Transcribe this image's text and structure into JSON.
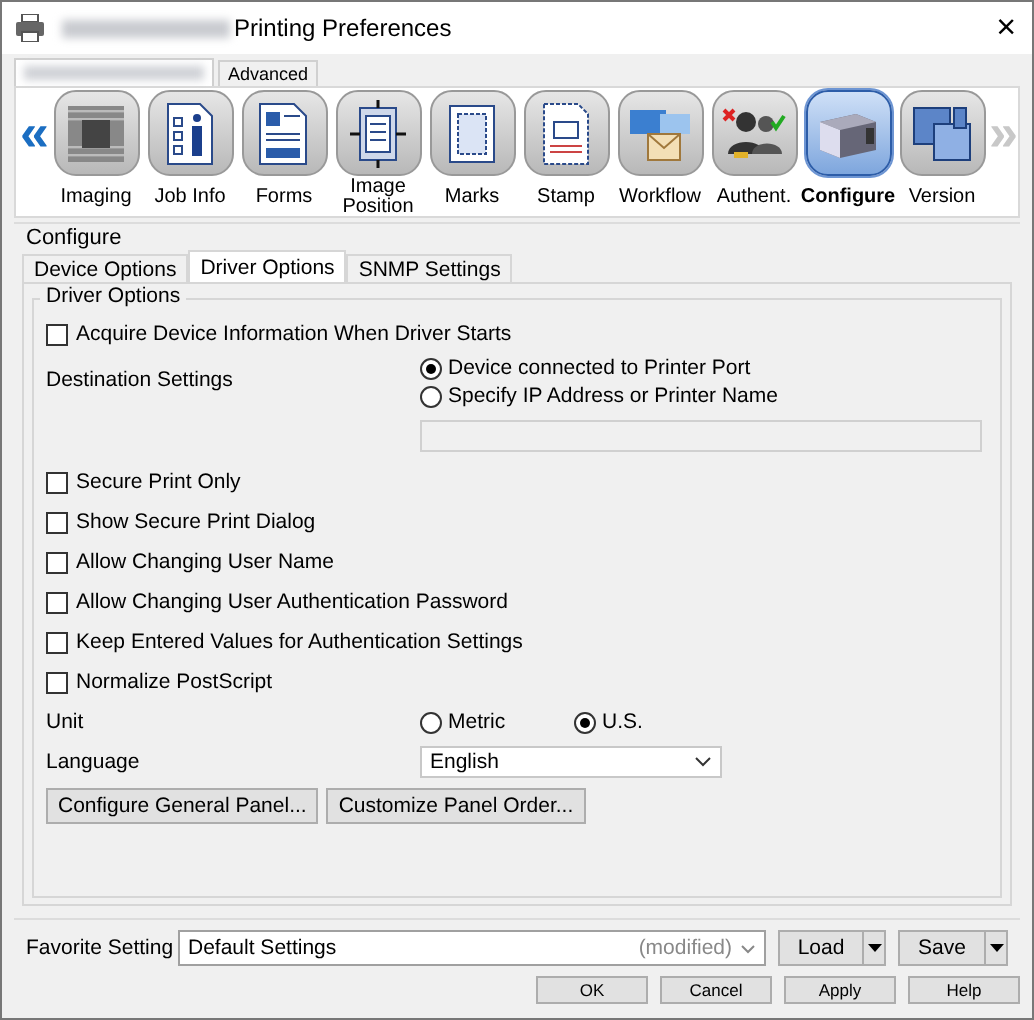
{
  "window": {
    "title": "Printing Preferences",
    "close": "×"
  },
  "top_tabs": [
    {
      "kind": "blurred",
      "selected": true
    },
    {
      "kind": "text",
      "label": "Advanced",
      "selected": false
    }
  ],
  "ribbon": {
    "prev": {
      "glyph": "«",
      "disabled": false
    },
    "next": {
      "glyph": "»",
      "disabled": true
    },
    "tabs": [
      {
        "label": "Imaging",
        "kind": "imaging",
        "selected": false
      },
      {
        "label": "Job Info",
        "kind": "jobinfo",
        "selected": false
      },
      {
        "label": "Forms",
        "kind": "forms",
        "selected": false
      },
      {
        "label": "Image Position",
        "kind": "position",
        "selected": false
      },
      {
        "label": "Marks",
        "kind": "marks",
        "selected": false
      },
      {
        "label": "Stamp",
        "kind": "stamp",
        "selected": false
      },
      {
        "label": "Workflow",
        "kind": "workflow",
        "selected": false
      },
      {
        "label": "Authent.",
        "kind": "authent",
        "selected": false
      },
      {
        "label": "Configure",
        "kind": "configure",
        "selected": true
      },
      {
        "label": "Version",
        "kind": "version",
        "selected": false
      }
    ]
  },
  "configure": {
    "title": "Configure",
    "tabs": [
      {
        "label": "Device Options",
        "selected": false
      },
      {
        "label": "Driver Options",
        "selected": true
      },
      {
        "label": "SNMP Settings",
        "selected": false
      }
    ],
    "group": {
      "title": "Driver Options",
      "rows": [
        {
          "kind": "checkbox",
          "label": "Acquire Device Information When Driver Starts",
          "checked": false
        },
        {
          "kind": "radio_group",
          "label": "Destination Settings",
          "options": [
            {
              "label": "Device connected to Printer Port",
              "selected": true
            },
            {
              "label": "Specify IP Address or Printer Name",
              "selected": false
            }
          ],
          "field": {
            "disabled": true
          }
        },
        {
          "kind": "checkbox",
          "label": "Secure Print Only",
          "checked": false
        },
        {
          "kind": "checkbox",
          "label": "Show Secure Print Dialog",
          "checked": false
        },
        {
          "kind": "checkbox",
          "label": "Allow Changing User Name",
          "checked": false
        },
        {
          "kind": "checkbox",
          "label": "Allow Changing User Authentication Password",
          "checked": false
        },
        {
          "kind": "checkbox",
          "label": "Keep Entered Values for Authentication Settings",
          "checked": false
        },
        {
          "kind": "checkbox",
          "label": "Normalize PostScript",
          "checked": false
        },
        {
          "kind": "radio_inline",
          "label": "Unit",
          "options": [
            {
              "label": "Metric",
              "selected": false
            },
            {
              "label": "U.S.",
              "selected": true
            }
          ]
        },
        {
          "kind": "dropdown",
          "label": "Language",
          "value": "English"
        },
        {
          "kind": "buttons",
          "buttons": [
            "Configure General Panel...",
            "Customize Panel Order..."
          ]
        }
      ]
    }
  },
  "favorite": {
    "label": "Favorite Setting",
    "value": "Default Settings",
    "note": "(modified)",
    "load": "Load",
    "save": "Save"
  },
  "buttons": [
    "OK",
    "Cancel",
    "Apply",
    "Help"
  ]
}
